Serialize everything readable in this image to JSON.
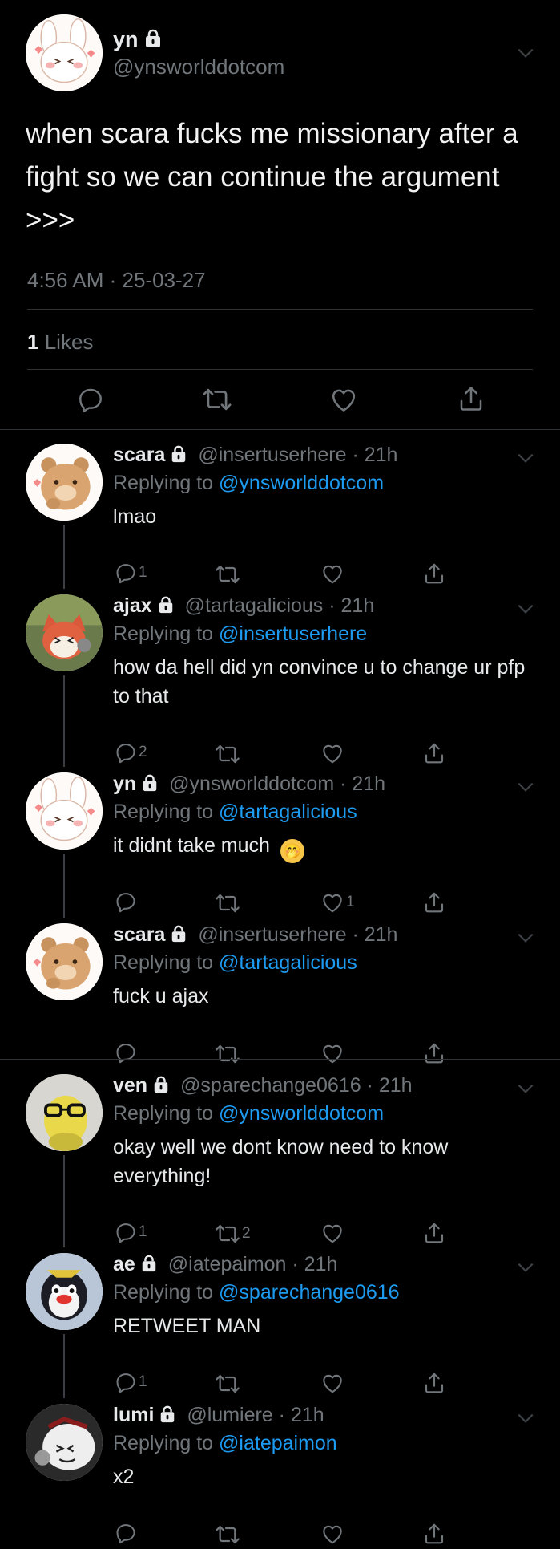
{
  "main_tweet": {
    "name": "yn",
    "handle": "@ynsworlddotcom",
    "text": "when scara fucks me missionary after a fight so we can continue the argument >>>",
    "time": "4:56 AM · 25-03-27",
    "likes_count": "1",
    "likes_label": "Likes"
  },
  "replies": [
    {
      "name": "scara",
      "handle": "@insertuserhere",
      "time": "21h",
      "replying_prefix": "Replying to",
      "replying_to": "@ynsworlddotcom",
      "text": "lmao",
      "reply_count": "1",
      "retweet_count": "",
      "like_count": ""
    },
    {
      "name": "ajax",
      "handle": "@tartagalicious",
      "time": "21h",
      "replying_prefix": "Replying to",
      "replying_to": "@insertuserhere",
      "text": "how da hell did yn convince u to change ur pfp to that",
      "reply_count": "2",
      "retweet_count": "",
      "like_count": ""
    },
    {
      "name": "yn",
      "handle": "@ynsworlddotcom",
      "time": "21h",
      "replying_prefix": "Replying to",
      "replying_to": "@tartagalicious",
      "text": "it didnt take much",
      "emoji": "🤭",
      "reply_count": "",
      "retweet_count": "",
      "like_count": "1"
    },
    {
      "name": "scara",
      "handle": "@insertuserhere",
      "time": "21h",
      "replying_prefix": "Replying to",
      "replying_to": "@tartagalicious",
      "text": "fuck u ajax",
      "reply_count": "",
      "retweet_count": "",
      "like_count": ""
    },
    {
      "name": "ven",
      "handle": "@sparechange0616",
      "time": "21h",
      "replying_prefix": "Replying to",
      "replying_to": "@ynsworlddotcom",
      "text": "okay well we dont know need to know everything!",
      "reply_count": "1",
      "retweet_count": "2",
      "like_count": ""
    },
    {
      "name": "ae",
      "handle": "@iatepaimon",
      "time": "21h",
      "replying_prefix": "Replying to",
      "replying_to": "@sparechange0616",
      "text": "RETWEET MAN",
      "reply_count": "1",
      "retweet_count": "",
      "like_count": ""
    },
    {
      "name": "lumi",
      "handle": "@lumiere",
      "time": "21h",
      "replying_prefix": "Replying to",
      "replying_to": "@iatepaimon",
      "text": "x2",
      "reply_count": "",
      "retweet_count": "",
      "like_count": ""
    }
  ],
  "colors": {
    "background": "#000000",
    "accent": "#1d9bf0",
    "muted": "#71767b",
    "divider": "#2f3336"
  },
  "icons": [
    "lock-icon",
    "chevron-down-icon",
    "reply-icon",
    "retweet-icon",
    "like-icon",
    "share-icon"
  ]
}
